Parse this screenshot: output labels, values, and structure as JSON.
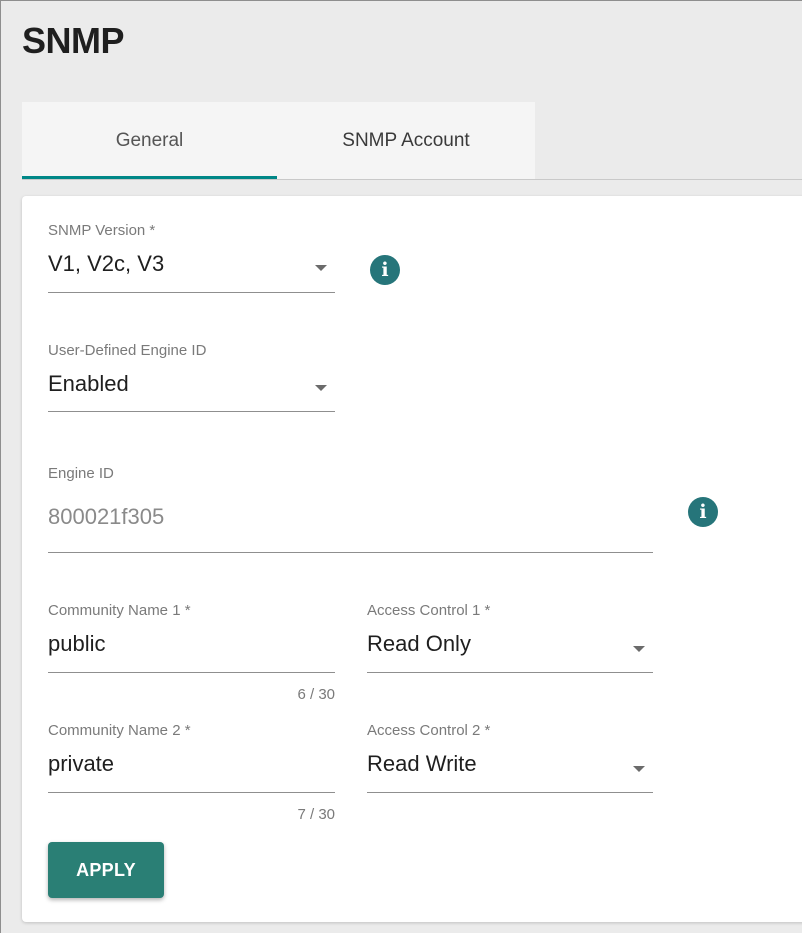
{
  "page": {
    "title": "SNMP"
  },
  "tabs": [
    {
      "label": "General",
      "active": true
    },
    {
      "label": "SNMP Account",
      "active": false
    }
  ],
  "form": {
    "snmp_version": {
      "label": "SNMP Version *",
      "value": "V1, V2c, V3"
    },
    "user_defined_engine_id": {
      "label": "User-Defined Engine ID",
      "value": "Enabled"
    },
    "engine_id": {
      "label": "Engine ID",
      "value": "800021f305"
    },
    "community_name_1": {
      "label": "Community Name 1 *",
      "value": "public",
      "counter": "6 / 30"
    },
    "access_control_1": {
      "label": "Access Control 1 *",
      "value": "Read Only"
    },
    "community_name_2": {
      "label": "Community Name 2 *",
      "value": "private",
      "counter": "7 / 30"
    },
    "access_control_2": {
      "label": "Access Control 2 *",
      "value": "Read Write"
    }
  },
  "actions": {
    "apply_label": "APPLY"
  },
  "icons": {
    "info": "info-icon",
    "dropdown": "chevron-down-icon"
  },
  "colors": {
    "accent": "#008787",
    "button": "#2a7f75",
    "info_icon": "#26757a"
  }
}
